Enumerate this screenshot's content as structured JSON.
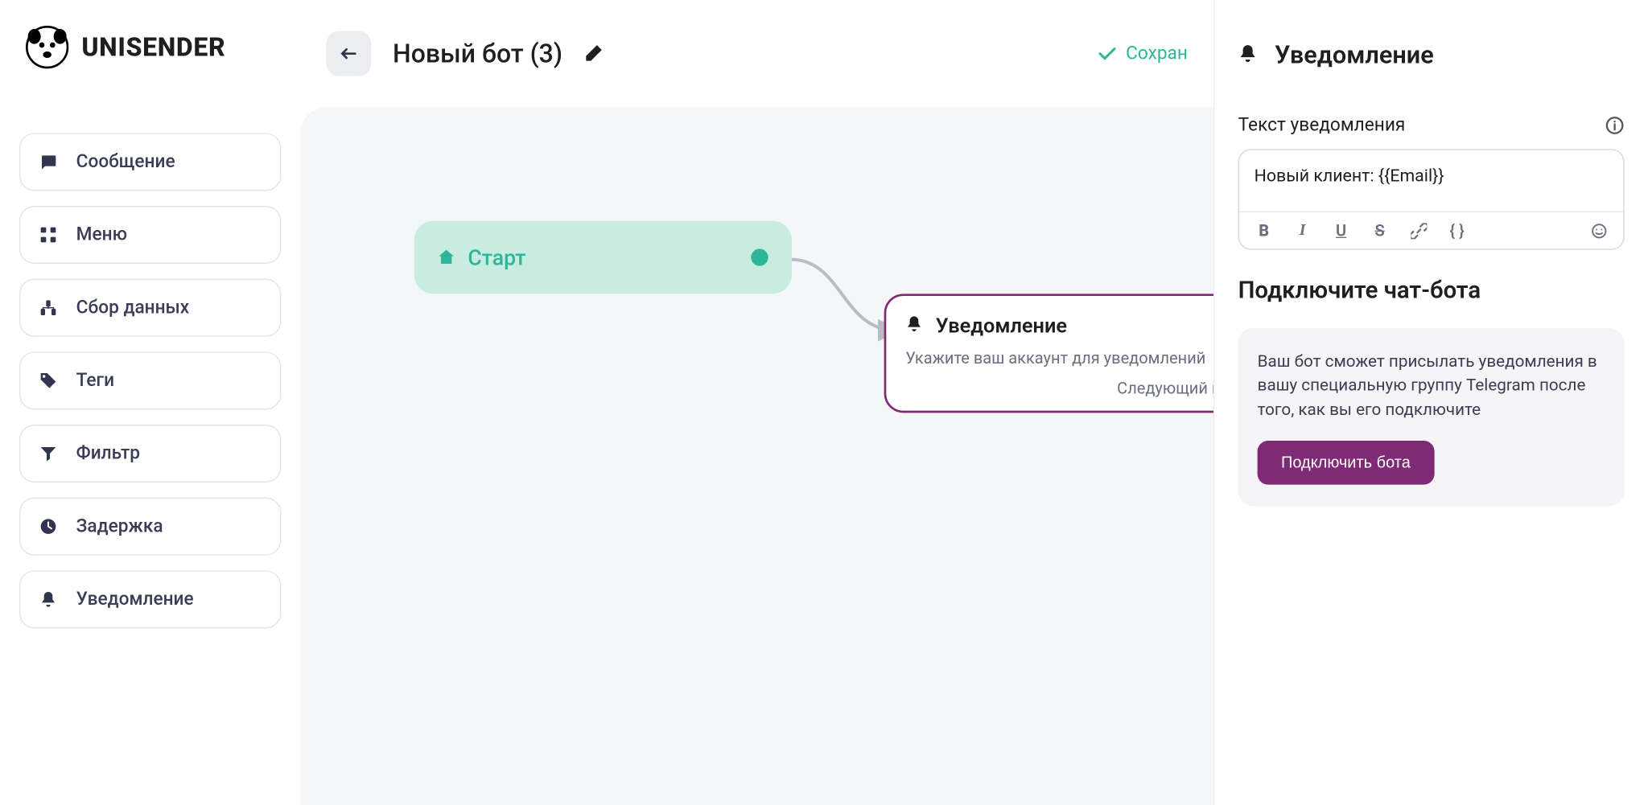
{
  "logo": {
    "text": "UNISENDER"
  },
  "sidebar": {
    "items": [
      {
        "label": "Сообщение"
      },
      {
        "label": "Меню"
      },
      {
        "label": "Сбор данных"
      },
      {
        "label": "Теги"
      },
      {
        "label": "Фильтр"
      },
      {
        "label": "Задержка"
      },
      {
        "label": "Уведомление"
      }
    ]
  },
  "header": {
    "title": "Новый бот (3)",
    "save_status": "Сохран"
  },
  "canvas": {
    "start_node": {
      "label": "Старт"
    },
    "notif_node": {
      "title": "Уведомление",
      "hint": "Укажите ваш аккаунт для уведомлений",
      "next": "Следующий шаг"
    }
  },
  "panel": {
    "title": "Уведомление",
    "field_label": "Текст уведомления",
    "editor_value": "Новый клиент: {{Email}}",
    "section_title": "Подключите чат-бота",
    "connect_desc": "Ваш бот сможет присылать уведомления в вашу специальную группу Telegram после того, как вы его подключите",
    "connect_btn": "Подключить бота"
  }
}
